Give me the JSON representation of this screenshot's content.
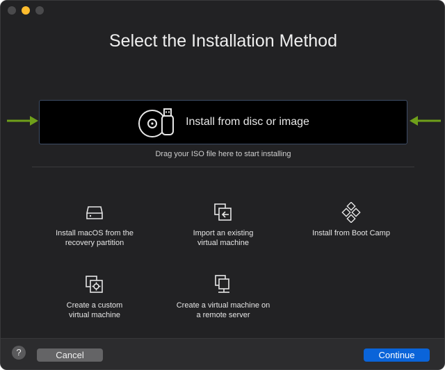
{
  "window": {
    "title": "Select the Installation Method",
    "traffic_lights": [
      "close",
      "minimize",
      "maximize"
    ]
  },
  "drop_zone": {
    "label": "Install from disc or image",
    "hint": "Drag your ISO file here to start installing",
    "icon": "disc-usb-icon"
  },
  "options": [
    {
      "id": "recovery",
      "label": "Install macOS from the\nrecovery partition",
      "icon": "drive-icon"
    },
    {
      "id": "import",
      "label": "Import an existing\nvirtual machine",
      "icon": "import-icon"
    },
    {
      "id": "bootcamp",
      "label": "Install from Boot Camp",
      "icon": "bootcamp-icon"
    },
    {
      "id": "custom",
      "label": "Create a custom\nvirtual machine",
      "icon": "custom-vm-icon"
    },
    {
      "id": "remote",
      "label": "Create a virtual machine on\na remote server",
      "icon": "remote-server-icon"
    }
  ],
  "footer": {
    "help": "?",
    "cancel": "Cancel",
    "continue": "Continue"
  },
  "colors": {
    "accent": "#0a64d9",
    "annotation_arrow": "#6fa01a",
    "traffic_minimize": "#febc2e"
  }
}
